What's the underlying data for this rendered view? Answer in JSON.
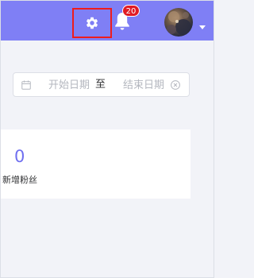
{
  "header": {
    "background_color": "#7f7ff5",
    "settings_icon": "gear-icon",
    "settings_highlight_color": "#ee1c1c",
    "notifications_icon": "bell-icon",
    "notification_count": "20",
    "badge_color": "#e01b24",
    "avatar_icon": "avatar",
    "avatar_dropdown_icon": "caret-down-icon"
  },
  "date_range": {
    "calendar_icon": "calendar-icon",
    "start_placeholder": "开始日期",
    "separator": "至",
    "end_placeholder": "结束日期",
    "clear_icon": "circle-close-icon"
  },
  "stats": {
    "value": "0",
    "label": "新增粉丝",
    "value_color": "#6f6ff0"
  }
}
